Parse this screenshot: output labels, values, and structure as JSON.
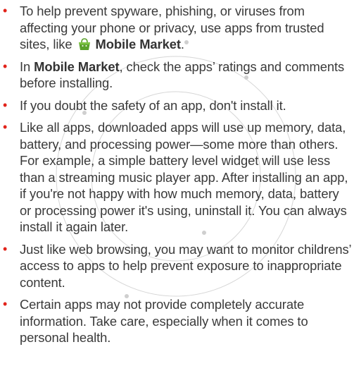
{
  "colors": {
    "bullet": "#e2231a",
    "text": "#3a3a3a",
    "market_icon_green": "#5aa12b"
  },
  "icon": "market-bag-icon",
  "items": [
    {
      "text_before": "To help prevent spyware, phishing, or viruses from affecting your phone or privacy, use apps from trusted sites, like ",
      "app_name": "Mobile Market",
      "text_after": "."
    },
    {
      "text_before": "In ",
      "app_name": "Mobile Market",
      "text_after": ", check the apps’ ratings and comments before installing."
    },
    {
      "text": "If you doubt the safety of an app, don't install it."
    },
    {
      "text": "Like all apps, downloaded apps will use up memory, data, battery, and processing power—some more than others. For example, a simple battery level widget will use less than a streaming music player app. After installing an app, if you're not happy with how much memory, data, battery or processing power it's using, uninstall it. You can always install it again later."
    },
    {
      "text": "Just like web browsing, you may want to monitor childrens’ access to apps to help prevent exposure to inappropriate content."
    },
    {
      "text": "Certain apps may not provide completely accurate information. Take care, especially when it comes to personal health."
    }
  ]
}
